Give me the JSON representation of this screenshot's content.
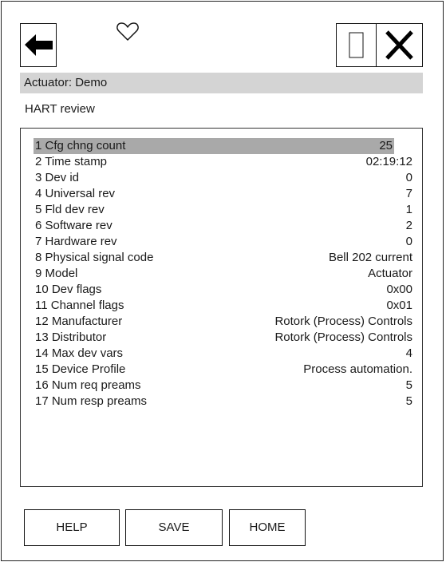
{
  "header": {
    "device_title": "Actuator: Demo",
    "page_title": "HART review"
  },
  "list": {
    "selected_index": 0,
    "rows": [
      {
        "label": "1 Cfg chng count",
        "value": "25"
      },
      {
        "label": "2 Time stamp",
        "value": "02:19:12"
      },
      {
        "label": "3 Dev id",
        "value": "0"
      },
      {
        "label": "4 Universal rev",
        "value": "7"
      },
      {
        "label": "5 Fld dev rev",
        "value": "1"
      },
      {
        "label": "6 Software rev",
        "value": "2"
      },
      {
        "label": "7 Hardware rev",
        "value": "0"
      },
      {
        "label": "8 Physical signal code",
        "value": "Bell 202 current"
      },
      {
        "label": "9 Model",
        "value": "Actuator"
      },
      {
        "label": "10 Dev flags",
        "value": "0x00"
      },
      {
        "label": "11 Channel flags",
        "value": "0x01"
      },
      {
        "label": "12 Manufacturer",
        "value": "Rotork (Process) Controls"
      },
      {
        "label": "13 Distributor",
        "value": "Rotork (Process) Controls"
      },
      {
        "label": "14 Max dev vars",
        "value": "4"
      },
      {
        "label": "15 Device Profile",
        "value": "Process automation."
      },
      {
        "label": "16 Num req preams",
        "value": "5"
      },
      {
        "label": "17 Num resp preams",
        "value": "5"
      }
    ]
  },
  "buttons": {
    "help": "HELP",
    "save": "SAVE",
    "home": "HOME"
  },
  "icons": {
    "back": "back-arrow-icon",
    "favorite": "heart-icon",
    "restore": "window-restore-icon",
    "close": "close-icon"
  }
}
